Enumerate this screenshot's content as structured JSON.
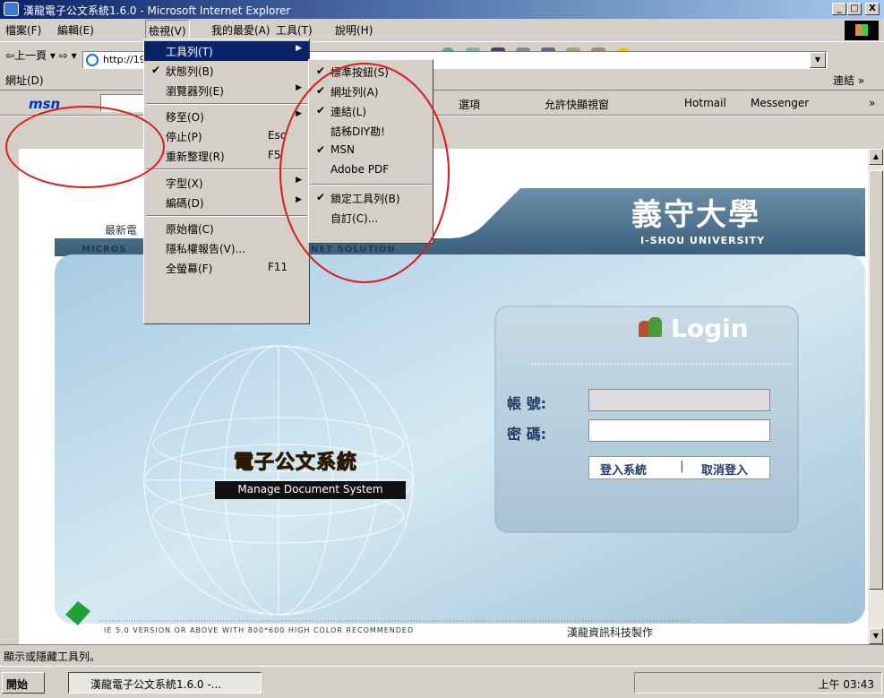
{
  "window": {
    "title": "漢龍電子公文系統1.6.0 - Microsoft Internet Explorer",
    "buttons": [
      "_",
      "□",
      "X"
    ]
  },
  "menubar": {
    "items": [
      "檔案(F)",
      "編輯(E)",
      "檢視(V)",
      "我的最愛(A)",
      "工具(T)",
      "說明(H)"
    ]
  },
  "toolbar": {
    "back": "上一頁",
    "address_label": "網址(D)",
    "address_value": "http://19",
    "links": "連結"
  },
  "msnbar": {
    "logo": "msn",
    "options": "選項",
    "popups": "允許快顯視窗",
    "hotmail": "Hotmail",
    "messenger": "Messenger"
  },
  "view_menu": [
    {
      "label": "工具列(T)",
      "check": "",
      "shortcut": "",
      "submenu": true,
      "highlight": true
    },
    {
      "label": "狀態列(B)",
      "check": "✔",
      "shortcut": "",
      "submenu": false
    },
    {
      "label": "瀏覽器列(E)",
      "check": "",
      "shortcut": "",
      "submenu": true
    },
    {
      "label": "移至(O)",
      "check": "",
      "shortcut": "",
      "submenu": true
    },
    {
      "label": "停止(P)",
      "check": "",
      "shortcut": "Esc",
      "submenu": false
    },
    {
      "label": "重新整理(R)",
      "check": "",
      "shortcut": "F5",
      "submenu": false
    },
    {
      "label": "字型(X)",
      "check": "",
      "shortcut": "",
      "submenu": true
    },
    {
      "label": "編碼(D)",
      "check": "",
      "shortcut": "",
      "submenu": true
    },
    {
      "label": "原始檔(C)",
      "check": "",
      "shortcut": "",
      "submenu": false
    },
    {
      "label": "隱私權報告(V)...",
      "check": "",
      "shortcut": "",
      "submenu": false
    },
    {
      "label": "全螢幕(F)",
      "check": "",
      "shortcut": "F11",
      "submenu": false
    }
  ],
  "toolbar_submenu": [
    {
      "label": "標準按鈕(S)",
      "check": "✔"
    },
    {
      "label": "網址列(A)",
      "check": "✔"
    },
    {
      "label": "連結(L)",
      "check": "✔"
    },
    {
      "label": "詰秭DIY勘!",
      "check": ""
    },
    {
      "label": "MSN",
      "check": "✔"
    },
    {
      "label": "Adobe PDF",
      "check": ""
    },
    {
      "label": "鎖定工具列(B)",
      "check": "✔"
    },
    {
      "label": "自訂(C)...",
      "check": ""
    }
  ],
  "page": {
    "univ_cn": "義守大學",
    "univ_en": "I-SHOU UNIVERSITY",
    "banner_left_cn": "最新電",
    "banner_left_en": "MICROS",
    "banner_mid_en": "NET SOLUTION",
    "login_title": "Login",
    "account_label": "帳 號:",
    "password_label": "密 碼:",
    "login_button": "登入系統",
    "cancel_button": "取消登入",
    "system_cn": "電子公文系統",
    "system_en": "Manage Document System",
    "footer_en": "IE 5.0 VERSION OR ABOVE WITH 800*600 HIGH COLOR RECOMMENDED",
    "footer_cn": "漢龍資訊科技製作"
  },
  "status": {
    "text": "顯示或隱藏工具列。"
  },
  "taskbar": {
    "start": "開始",
    "task": "漢龍電子公文系統1.6.0 -...",
    "clock": "上午 03:43"
  }
}
